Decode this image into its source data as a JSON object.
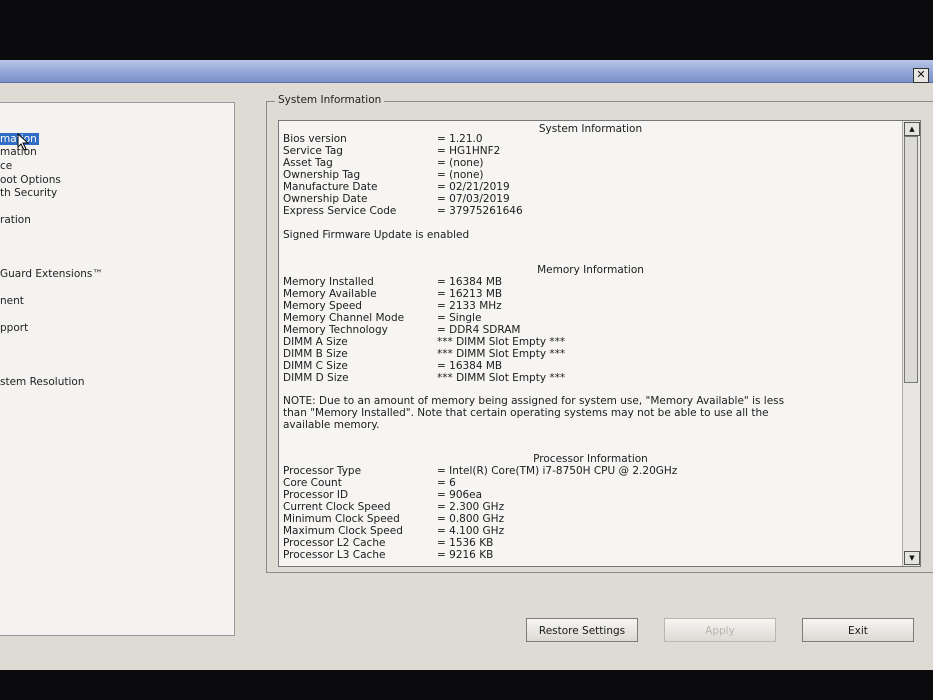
{
  "window": {
    "close_glyph": "✕"
  },
  "nav": {
    "items": [
      {
        "label": "mation",
        "selected": true
      },
      {
        "label": "mation",
        "selected": false
      },
      {
        "label": "ce",
        "selected": false
      },
      {
        "label": "oot Options",
        "selected": false
      },
      {
        "label": "th Security",
        "selected": false
      },
      {
        "label": "ration",
        "selected": false
      },
      {
        "label": "Guard Extensions™",
        "selected": false
      },
      {
        "label": "nent",
        "selected": false
      },
      {
        "label": "pport",
        "selected": false
      },
      {
        "label": "stem Resolution",
        "selected": false
      }
    ]
  },
  "group": {
    "title": "System Information"
  },
  "system": {
    "heading": "System Information",
    "rows": [
      {
        "k": "Bios version",
        "v": "= 1.21.0"
      },
      {
        "k": "Service Tag",
        "v": "= HG1HNF2"
      },
      {
        "k": "Asset Tag",
        "v": "= (none)"
      },
      {
        "k": "Ownership Tag",
        "v": "= (none)"
      },
      {
        "k": "Manufacture Date",
        "v": "= 02/21/2019"
      },
      {
        "k": "Ownership Date",
        "v": "= 07/03/2019"
      },
      {
        "k": "Express Service Code",
        "v": "= 37975261646"
      }
    ],
    "firmware_note": "Signed Firmware Update is enabled"
  },
  "memory": {
    "heading": "Memory Information",
    "rows": [
      {
        "k": "Memory Installed",
        "v": "= 16384 MB"
      },
      {
        "k": "Memory Available",
        "v": "= 16213 MB"
      },
      {
        "k": "Memory Speed",
        "v": "= 2133 MHz"
      },
      {
        "k": "Memory Channel Mode",
        "v": "= Single"
      },
      {
        "k": "Memory Technology",
        "v": "= DDR4 SDRAM"
      },
      {
        "k": "DIMM A Size",
        "v": "*** DIMM Slot Empty ***"
      },
      {
        "k": "DIMM B Size",
        "v": "*** DIMM Slot Empty ***"
      },
      {
        "k": "DIMM C Size",
        "v": "= 16384 MB"
      },
      {
        "k": "DIMM D Size",
        "v": "*** DIMM Slot Empty ***"
      }
    ],
    "note_lines": [
      "NOTE: Due to an amount of memory being assigned for system use, \"Memory Available\" is less",
      "than \"Memory Installed\". Note that certain operating systems may not be able to use all the",
      "available memory."
    ]
  },
  "processor": {
    "heading": "Processor Information",
    "rows": [
      {
        "k": "Processor Type",
        "v": "= Intel(R) Core(TM) i7-8750H CPU @ 2.20GHz"
      },
      {
        "k": "Core Count",
        "v": "= 6"
      },
      {
        "k": "Processor ID",
        "v": "= 906ea"
      },
      {
        "k": "Current Clock Speed",
        "v": "= 2.300 GHz"
      },
      {
        "k": "Minimum Clock Speed",
        "v": "= 0.800 GHz"
      },
      {
        "k": "Maximum Clock Speed",
        "v": "= 4.100 GHz"
      },
      {
        "k": "Processor L2 Cache",
        "v": "= 1536 KB"
      },
      {
        "k": "Processor L3 Cache",
        "v": "= 9216 KB"
      }
    ]
  },
  "scroll": {
    "up_glyph": "▲",
    "down_glyph": "▼"
  },
  "buttons": {
    "restore": "Restore Settings",
    "apply": "Apply",
    "exit": "Exit"
  },
  "colors": {
    "selection": "#2f6ec4",
    "titlebar": "#8ea3d4"
  }
}
